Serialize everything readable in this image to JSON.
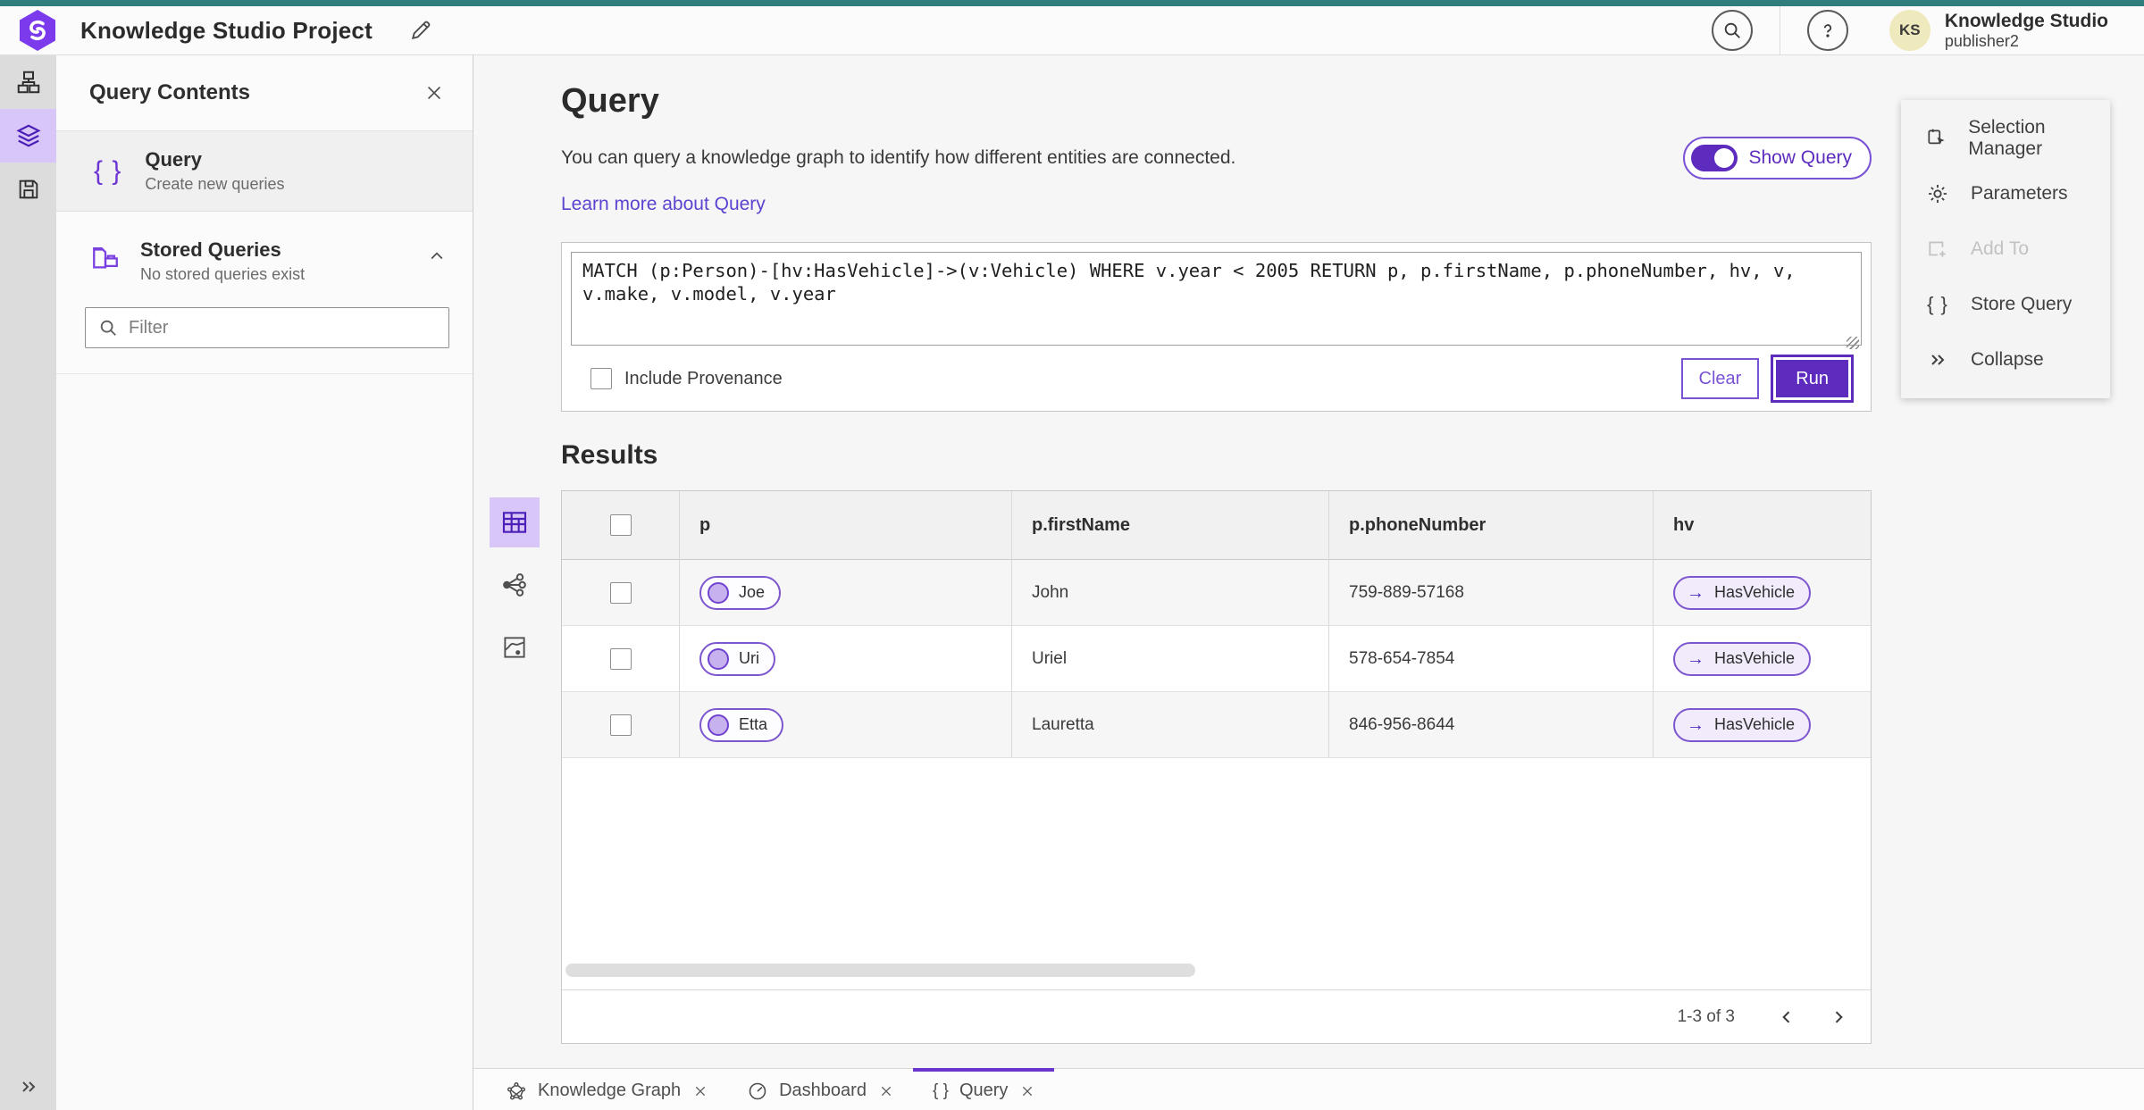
{
  "topbar": {
    "title": "Knowledge Studio Project",
    "account": {
      "initials": "KS",
      "name": "Knowledge Studio",
      "username": "publisher2"
    }
  },
  "icons": {
    "braces": "{ }",
    "arrow_right": "→"
  },
  "left_panel": {
    "title": "Query Contents",
    "query_item": {
      "title": "Query",
      "subtitle": "Create new queries"
    },
    "stored_queries": {
      "title": "Stored Queries",
      "subtitle": "No stored queries exist"
    },
    "filter": {
      "placeholder": "Filter",
      "value": ""
    }
  },
  "query_section": {
    "title": "Query",
    "description": "You can query a knowledge graph to identify how different entities are connected.",
    "learn_more": "Learn more about Query",
    "show_query_label": "Show Query",
    "show_query_on": true,
    "query_text": "MATCH (p:Person)-[hv:HasVehicle]->(v:Vehicle) WHERE v.year < 2005 RETURN p, p.firstName, p.phoneNumber, hv, v, v.make, v.model, v.year",
    "include_provenance_label": "Include Provenance",
    "include_provenance_checked": false,
    "clear_label": "Clear",
    "run_label": "Run"
  },
  "results": {
    "title": "Results",
    "columns": [
      "p",
      "p.firstName",
      "p.phoneNumber",
      "hv"
    ],
    "rows": [
      {
        "p": "Joe",
        "firstName": "John",
        "phoneNumber": "759-889-57168",
        "hv": "HasVehicle"
      },
      {
        "p": "Uri",
        "firstName": "Uriel",
        "phoneNumber": "578-654-7854",
        "hv": "HasVehicle"
      },
      {
        "p": "Etta",
        "firstName": "Lauretta",
        "phoneNumber": "846-956-8644",
        "hv": "HasVehicle"
      }
    ],
    "pagination_label": "1-3 of 3"
  },
  "right_panel": {
    "items": [
      {
        "label": "Selection Manager",
        "disabled": false
      },
      {
        "label": "Parameters",
        "disabled": false
      },
      {
        "label": "Add To",
        "disabled": true
      },
      {
        "label": "Store Query",
        "disabled": false
      },
      {
        "label": "Collapse",
        "disabled": false
      }
    ]
  },
  "bottom_tabs": [
    {
      "label": "Knowledge Graph",
      "active": false
    },
    {
      "label": "Dashboard",
      "active": false
    },
    {
      "label": "Query",
      "active": true
    }
  ],
  "colors": {
    "accent_purple": "#5d2bbe",
    "accent_purple_light": "#d9c6f8",
    "teal_strip": "#2f7d7d",
    "link_purple": "#5d43cf",
    "avatar_yellow": "#efeabd"
  }
}
